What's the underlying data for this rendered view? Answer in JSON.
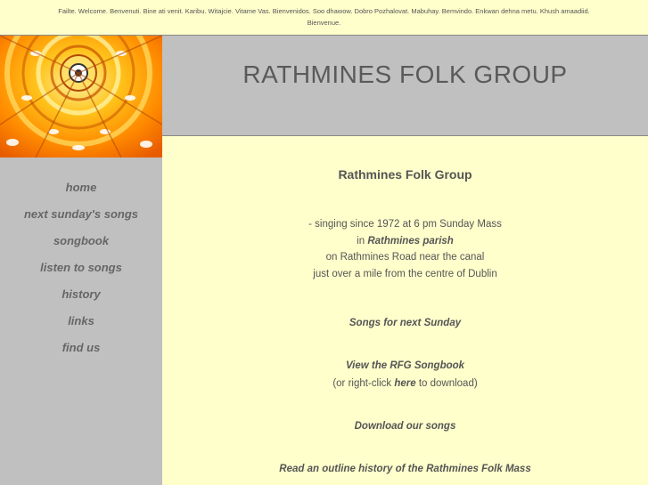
{
  "welcome": {
    "line1": "Failte. Welcome. Benvenuti. Bine ati venit. Karibu. Witajcie. Vitame Vas. Bienvenidos. Soo dhawow. Dobro Pozhalovat. Mabuhay. Bemvindo. Enkwan dehna metu. Khush amaadiid.",
    "line2": "Bienvenue."
  },
  "header": {
    "title": "RATHMINES FOLK GROUP"
  },
  "sidebar": {
    "items": [
      {
        "label": "home"
      },
      {
        "label": "next sunday's songs"
      },
      {
        "label": "songbook"
      },
      {
        "label": "listen to songs"
      },
      {
        "label": "history"
      },
      {
        "label": "links"
      },
      {
        "label": "find us"
      }
    ]
  },
  "main": {
    "title": "Rathmines Folk Group",
    "intro": {
      "line1": "- singing since 1972 at 6 pm Sunday Mass",
      "line2_prefix": "in",
      "line2_link": "Rathmines parish",
      "line3": "on Rathmines Road near the canal",
      "line4": "just over a mile from the centre of Dublin"
    },
    "songs_next_sunday": "Songs for next Sunday",
    "songbook_link": "View the RFG Songbook",
    "right_click_prefix": "(or right-click",
    "right_click_link": "here",
    "right_click_suffix": "to download)",
    "download_songs": "Download our songs",
    "history_link": "Read an outline history of the Rathmines Folk Mass"
  },
  "colors": {
    "background": "#ffffcc",
    "panel_grey": "#c0c0c0",
    "text": "#555555",
    "dome_gold": "#f39a00"
  }
}
